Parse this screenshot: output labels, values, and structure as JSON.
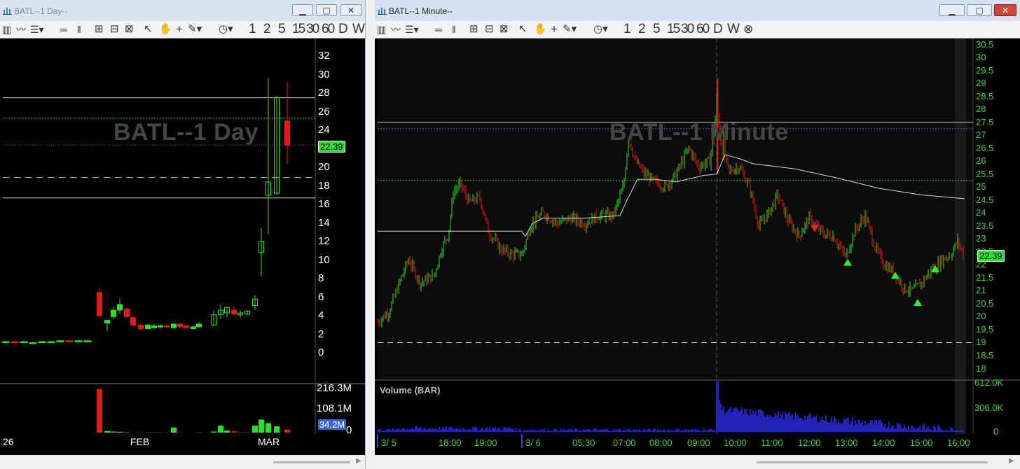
{
  "colors": {
    "up": "#2fdc2f",
    "down": "#e11b1b",
    "grid": "#ffffff",
    "green_line": "#2ccc2c",
    "blue_line": "#3a6fd1",
    "volume_bar": "#2d2df2",
    "axis_text": "#3cd23c",
    "vwap": "#d8d8d8"
  },
  "window_daily": {
    "title": "BATL--1 Day--",
    "watermark": "BATL--1 Day",
    "toolbar": {
      "periods": [
        "1",
        "2",
        "5",
        "15",
        "30",
        "60",
        "D",
        "W"
      ]
    },
    "price_axis": [
      "32",
      "30",
      "28",
      "26",
      "24",
      "22",
      "20",
      "18",
      "16",
      "14",
      "12",
      "10",
      "8",
      "6",
      "4",
      "2",
      "0"
    ],
    "last_price": "22.39",
    "volume_axis": [
      "216.3M",
      "108.1M",
      "0"
    ],
    "last_volume": "34.2M",
    "time_axis": [
      "26",
      "FEB",
      "MAR"
    ]
  },
  "window_minute": {
    "title": "BATL--1 Minute--",
    "watermark": "BATL--1 Minute",
    "toolbar": {
      "periods": [
        "1",
        "2",
        "5",
        "15",
        "30",
        "60",
        "D",
        "W"
      ]
    },
    "price_axis": [
      "30.5",
      "30",
      "29.5",
      "29",
      "28.5",
      "28",
      "27.5",
      "27",
      "26.5",
      "26",
      "25.5",
      "25",
      "24.5",
      "24",
      "23.5",
      "23",
      "22.5",
      "22",
      "21.5",
      "21",
      "20.5",
      "20",
      "19.5",
      "19",
      "18.5",
      "18"
    ],
    "last_price": "22.39",
    "volume_title": "Volume (BAR)",
    "volume_axis": [
      "612.0K",
      "306.0K",
      "0"
    ],
    "time_axis": [
      "3/ 5",
      "18:00",
      "19:00",
      "3/ 6",
      "05:30",
      "07:00",
      "08:00",
      "09:00",
      "10:00",
      "11:00",
      "12:00",
      "13:00",
      "14:00",
      "15:00",
      "16:00"
    ]
  },
  "chart_data": [
    {
      "type": "candlestick",
      "title": "BATL--1 Day",
      "xlabel": "",
      "ylabel": "",
      "ylim": [
        0,
        32.5
      ],
      "x_ticks": [
        "26",
        "FEB",
        "MAR"
      ],
      "candles": [
        {
          "o": 1.2,
          "h": 1.3,
          "l": 1.1,
          "c": 1.2
        },
        {
          "o": 1.2,
          "h": 1.3,
          "l": 1.1,
          "c": 1.1
        },
        {
          "o": 1.2,
          "h": 1.3,
          "l": 1.1,
          "c": 1.2
        },
        {
          "o": 1.1,
          "h": 1.2,
          "l": 1.0,
          "c": 1.1
        },
        {
          "o": 1.1,
          "h": 1.3,
          "l": 1.1,
          "c": 1.2
        },
        {
          "o": 1.2,
          "h": 1.3,
          "l": 1.1,
          "c": 1.2
        },
        {
          "o": 1.2,
          "h": 1.3,
          "l": 1.1,
          "c": 1.3
        },
        {
          "o": 1.3,
          "h": 1.3,
          "l": 1.2,
          "c": 1.2
        },
        {
          "o": 1.2,
          "h": 1.3,
          "l": 1.1,
          "c": 1.3
        },
        {
          "o": 1.3,
          "h": 1.4,
          "l": 1.2,
          "c": 1.3
        },
        {
          "o": 6.5,
          "h": 6.9,
          "l": 4.0,
          "c": 4.0
        },
        {
          "o": 3.2,
          "h": 3.5,
          "l": 2.3,
          "c": 3.5
        },
        {
          "o": 3.9,
          "h": 5.0,
          "l": 3.6,
          "c": 4.6
        },
        {
          "o": 4.6,
          "h": 5.8,
          "l": 4.2,
          "c": 5.2
        },
        {
          "o": 4.7,
          "h": 4.9,
          "l": 3.8,
          "c": 3.9
        },
        {
          "o": 3.8,
          "h": 3.9,
          "l": 2.8,
          "c": 3.0
        },
        {
          "o": 3.0,
          "h": 3.2,
          "l": 2.4,
          "c": 2.6
        },
        {
          "o": 2.6,
          "h": 3.1,
          "l": 2.5,
          "c": 3.0
        },
        {
          "o": 2.7,
          "h": 3.1,
          "l": 2.6,
          "c": 2.9
        },
        {
          "o": 2.8,
          "h": 3.1,
          "l": 2.6,
          "c": 2.9
        },
        {
          "o": 2.9,
          "h": 3.0,
          "l": 2.7,
          "c": 2.8
        },
        {
          "o": 2.7,
          "h": 3.2,
          "l": 2.6,
          "c": 3.1
        },
        {
          "o": 3.1,
          "h": 3.2,
          "l": 2.7,
          "c": 2.8
        },
        {
          "o": 2.9,
          "h": 3.0,
          "l": 2.6,
          "c": 2.7
        },
        {
          "o": 2.6,
          "h": 2.9,
          "l": 2.5,
          "c": 2.8
        },
        {
          "o": 2.8,
          "h": 3.3,
          "l": 2.7,
          "c": 3.1
        },
        {
          "o": 3.0,
          "h": 4.5,
          "l": 2.9,
          "c": 4.1
        },
        {
          "o": 4.1,
          "h": 5.2,
          "l": 3.6,
          "c": 4.6
        },
        {
          "o": 4.3,
          "h": 5.0,
          "l": 3.8,
          "c": 4.9
        },
        {
          "o": 4.6,
          "h": 5.0,
          "l": 4.0,
          "c": 4.2
        },
        {
          "o": 4.1,
          "h": 4.6,
          "l": 3.8,
          "c": 4.3
        },
        {
          "o": 4.2,
          "h": 4.6,
          "l": 4.0,
          "c": 4.5
        },
        {
          "o": 5.1,
          "h": 6.2,
          "l": 4.6,
          "c": 5.8
        },
        {
          "o": 10.8,
          "h": 13.5,
          "l": 8.2,
          "c": 12.0
        },
        {
          "o": 17.0,
          "h": 29.6,
          "l": 12.8,
          "c": 18.4
        },
        {
          "o": 17.2,
          "h": 27.7,
          "l": 17.0,
          "c": 27.5
        },
        {
          "o": 25.0,
          "h": 29.2,
          "l": 20.4,
          "c": 22.39
        }
      ],
      "x_index": [
        0,
        1,
        2,
        3,
        4,
        5,
        6,
        7,
        8,
        9,
        10,
        11,
        12,
        13,
        14,
        15,
        16,
        17,
        18,
        19,
        20,
        21,
        22,
        23,
        24,
        25,
        26,
        27,
        28,
        29,
        30,
        31,
        32,
        33,
        34,
        35,
        36
      ],
      "volume": [
        0,
        0,
        0,
        0,
        0,
        0,
        0,
        0,
        0,
        0,
        207,
        8,
        5,
        4,
        3,
        0,
        1,
        1,
        1,
        1,
        1,
        24,
        1,
        0,
        0,
        1,
        5,
        34,
        10,
        6,
        1,
        1,
        33,
        62,
        45,
        30,
        14,
        34.2
      ],
      "reference_lines": [
        {
          "y": 27.5,
          "style": "solid"
        },
        {
          "y": 25.3,
          "style": "dotted-green"
        },
        {
          "y": 22.39,
          "style": "dotted-red"
        },
        {
          "y": 18.9,
          "style": "dashed"
        },
        {
          "y": 16.7,
          "style": "solid"
        }
      ]
    },
    {
      "type": "candlestick",
      "title": "BATL--1 Minute",
      "xlabel": "",
      "ylabel": "",
      "ylim": [
        17.8,
        30.6
      ],
      "x_ticks": [
        "3/ 5",
        "18:00",
        "19:00",
        "3/ 6",
        "05:30",
        "07:00",
        "08:00",
        "09:00",
        "10:00",
        "11:00",
        "12:00",
        "13:00",
        "14:00",
        "15:00",
        "16:00"
      ],
      "reference_lines": [
        {
          "y": 27.5,
          "style": "solid"
        },
        {
          "y": 27.25,
          "style": "dotted-blue"
        },
        {
          "y": 25.25,
          "style": "dotted-green"
        },
        {
          "y": 19.0,
          "style": "dashed"
        }
      ],
      "markers": [
        {
          "x": "12:15",
          "y": 23.4,
          "kind": "sell"
        },
        {
          "x": "13:05",
          "y": 22.1,
          "kind": "buy"
        },
        {
          "x": "14:20",
          "y": 21.7,
          "kind": "buy"
        },
        {
          "x": "14:55",
          "y": 20.5,
          "kind": "buy"
        },
        {
          "x": "15:30",
          "y": 21.9,
          "kind": "buy"
        }
      ],
      "last_price": 22.39
    }
  ]
}
